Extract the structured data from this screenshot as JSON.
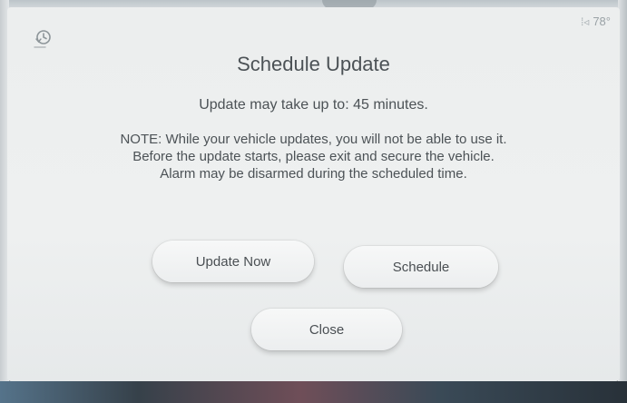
{
  "status_bar": {
    "signal_glyph": "⁞◃",
    "temperature": "78°"
  },
  "icons": {
    "history": "clock-history-icon"
  },
  "dialog": {
    "title": "Schedule Update",
    "duration_text": "Update may take up to: 45 minutes.",
    "note_lines": [
      "NOTE: While your vehicle updates, you will not be able to use it.",
      "Before the update starts, please exit and secure the vehicle.",
      "Alarm may be disarmed during the scheduled time."
    ],
    "buttons": {
      "update_now": "Update Now",
      "schedule": "Schedule",
      "close": "Close"
    }
  }
}
